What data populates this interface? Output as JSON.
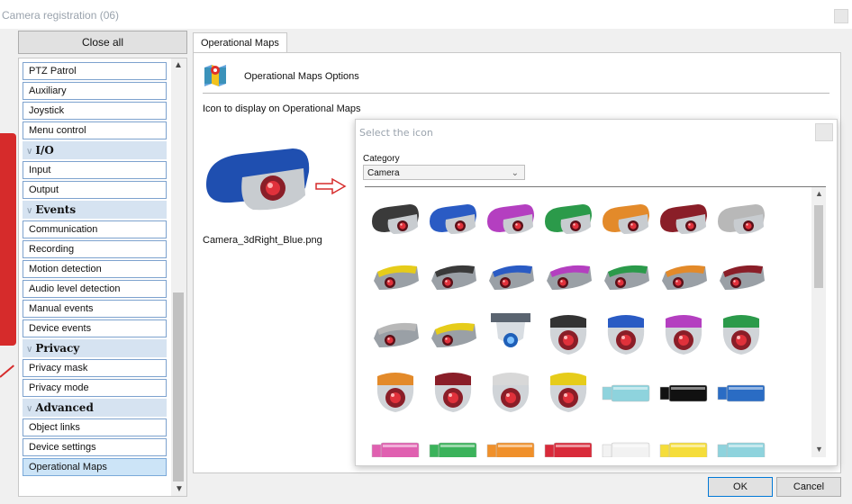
{
  "window": {
    "title": "Camera registration (06)"
  },
  "left_panel": {
    "close_all": "Close all",
    "items": [
      {
        "type": "item",
        "label": "PTZ Patrol"
      },
      {
        "type": "item",
        "label": "Auxiliary"
      },
      {
        "type": "item",
        "label": "Joystick"
      },
      {
        "type": "item",
        "label": "Menu control"
      },
      {
        "type": "group",
        "label": "I/O"
      },
      {
        "type": "item",
        "label": "Input"
      },
      {
        "type": "item",
        "label": "Output"
      },
      {
        "type": "group",
        "label": "Events"
      },
      {
        "type": "item",
        "label": "Communication"
      },
      {
        "type": "item",
        "label": "Recording"
      },
      {
        "type": "item",
        "label": "Motion detection"
      },
      {
        "type": "item",
        "label": "Audio level detection"
      },
      {
        "type": "item",
        "label": "Manual events"
      },
      {
        "type": "item",
        "label": "Device events"
      },
      {
        "type": "group",
        "label": "Privacy"
      },
      {
        "type": "item",
        "label": "Privacy mask"
      },
      {
        "type": "item",
        "label": "Privacy mode"
      },
      {
        "type": "group",
        "label": "Advanced"
      },
      {
        "type": "item",
        "label": "Object links"
      },
      {
        "type": "item",
        "label": "Device settings"
      },
      {
        "type": "item",
        "label": "Operational Maps",
        "selected": true
      }
    ]
  },
  "tab": {
    "label": "Operational Maps"
  },
  "content": {
    "header": "Operational Maps Options",
    "icon_label": "Icon to display on Operational Maps",
    "filename": "Camera_3dRight_Blue.png"
  },
  "dialog": {
    "title": "Select the icon",
    "category_label": "Category",
    "category_value": "Camera",
    "rows": [
      [
        {
          "kind": "bullet",
          "color": "#3a3a3a"
        },
        {
          "kind": "bullet",
          "color": "#2a5bc4"
        },
        {
          "kind": "bullet",
          "color": "#b43fc0"
        },
        {
          "kind": "bullet",
          "color": "#2b9a4a"
        },
        {
          "kind": "bullet",
          "color": "#e38a2a"
        },
        {
          "kind": "bullet",
          "color": "#8a1e28"
        },
        {
          "kind": "bullet",
          "color": "#b8b8b8"
        }
      ],
      [
        {
          "kind": "box",
          "color": "#e6cc1a"
        },
        {
          "kind": "box",
          "color": "#3a3a3a"
        },
        {
          "kind": "box",
          "color": "#2a5bc4"
        },
        {
          "kind": "box",
          "color": "#b43fc0"
        },
        {
          "kind": "box",
          "color": "#2b9a4a"
        },
        {
          "kind": "box",
          "color": "#e38a2a"
        },
        {
          "kind": "box",
          "color": "#8a1e28"
        }
      ],
      [
        {
          "kind": "box",
          "color": "#b8b8b8"
        },
        {
          "kind": "box",
          "color": "#e6cc1a"
        },
        {
          "kind": "ceiling",
          "color": "#5a6470"
        },
        {
          "kind": "dome",
          "color": "#333333"
        },
        {
          "kind": "dome",
          "color": "#2a5bc4"
        },
        {
          "kind": "dome",
          "color": "#b43fc0"
        },
        {
          "kind": "dome",
          "color": "#2b9a4a"
        }
      ],
      [
        {
          "kind": "dome",
          "color": "#e38a2a"
        },
        {
          "kind": "dome",
          "color": "#8a1e28"
        },
        {
          "kind": "dome",
          "color": "#d8d8d8"
        },
        {
          "kind": "dome",
          "color": "#e6cc1a"
        },
        {
          "kind": "flat",
          "color": "#8ed3dd"
        },
        {
          "kind": "flat",
          "color": "#111111"
        },
        {
          "kind": "flat",
          "color": "#2a6cc4"
        }
      ],
      [
        {
          "kind": "flat",
          "color": "#e060b0"
        },
        {
          "kind": "flat",
          "color": "#3bb35b"
        },
        {
          "kind": "flat",
          "color": "#f0902a"
        },
        {
          "kind": "flat",
          "color": "#d92a3a"
        },
        {
          "kind": "flat",
          "color": "#f2f2f2"
        },
        {
          "kind": "flat",
          "color": "#f5dd3a"
        },
        {
          "kind": "flat",
          "color": "#8ed3dd"
        }
      ]
    ]
  },
  "buttons": {
    "ok": "OK",
    "cancel": "Cancel"
  }
}
